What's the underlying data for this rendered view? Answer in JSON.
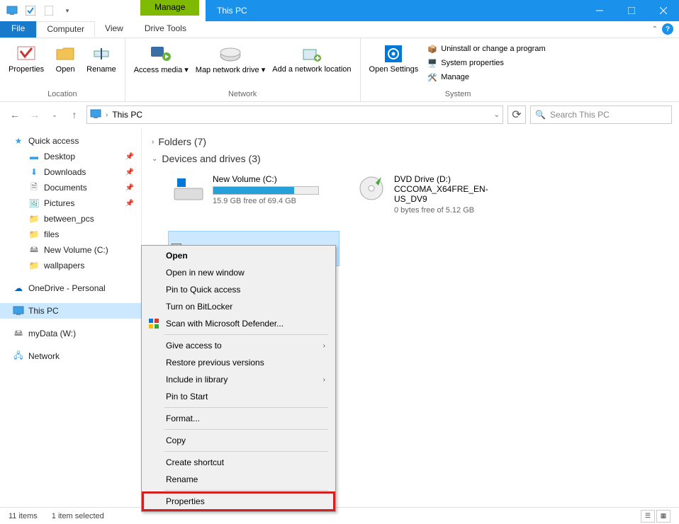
{
  "titlebar": {
    "manage": "Manage",
    "title": "This PC"
  },
  "tabs": {
    "file": "File",
    "computer": "Computer",
    "view": "View",
    "drive_tools": "Drive Tools"
  },
  "ribbon": {
    "location": {
      "label": "Location",
      "properties": "Properties",
      "open": "Open",
      "rename": "Rename"
    },
    "network": {
      "label": "Network",
      "access_media": "Access media",
      "map_drive": "Map network drive",
      "add_location": "Add a network location"
    },
    "open_settings": "Open Settings",
    "system": {
      "label": "System",
      "uninstall": "Uninstall or change a program",
      "props": "System properties",
      "manage": "Manage"
    }
  },
  "nav": {
    "location": "This PC",
    "search_placeholder": "Search This PC"
  },
  "sidebar": {
    "quick_access": "Quick access",
    "desktop": "Desktop",
    "downloads": "Downloads",
    "documents": "Documents",
    "pictures": "Pictures",
    "between_pcs": "between_pcs",
    "files": "files",
    "new_volume": "New Volume (C:)",
    "wallpapers": "wallpapers",
    "onedrive": "OneDrive - Personal",
    "this_pc": "This PC",
    "mydata": "myData (W:)",
    "network": "Network"
  },
  "sections": {
    "folders": "Folders (7)",
    "drives": "Devices and drives (3)"
  },
  "drives": {
    "c": {
      "name": "New Volume (C:)",
      "free": "15.9 GB free of 69.4 GB",
      "fill_pct": 77
    },
    "d": {
      "name": "DVD Drive (D:) CCCOMA_X64FRE_EN-US_DV9",
      "free": "0 bytes free of 5.12 GB"
    },
    "w": {
      "name": "myData (W:)"
    }
  },
  "context_menu": {
    "open": "Open",
    "open_new": "Open in new window",
    "pin_qa": "Pin to Quick access",
    "bitlocker": "Turn on BitLocker",
    "defender": "Scan with Microsoft Defender...",
    "give_access": "Give access to",
    "restore": "Restore previous versions",
    "include_lib": "Include in library",
    "pin_start": "Pin to Start",
    "format": "Format...",
    "copy": "Copy",
    "shortcut": "Create shortcut",
    "rename": "Rename",
    "properties": "Properties"
  },
  "status": {
    "items": "11 items",
    "selected": "1 item selected"
  }
}
